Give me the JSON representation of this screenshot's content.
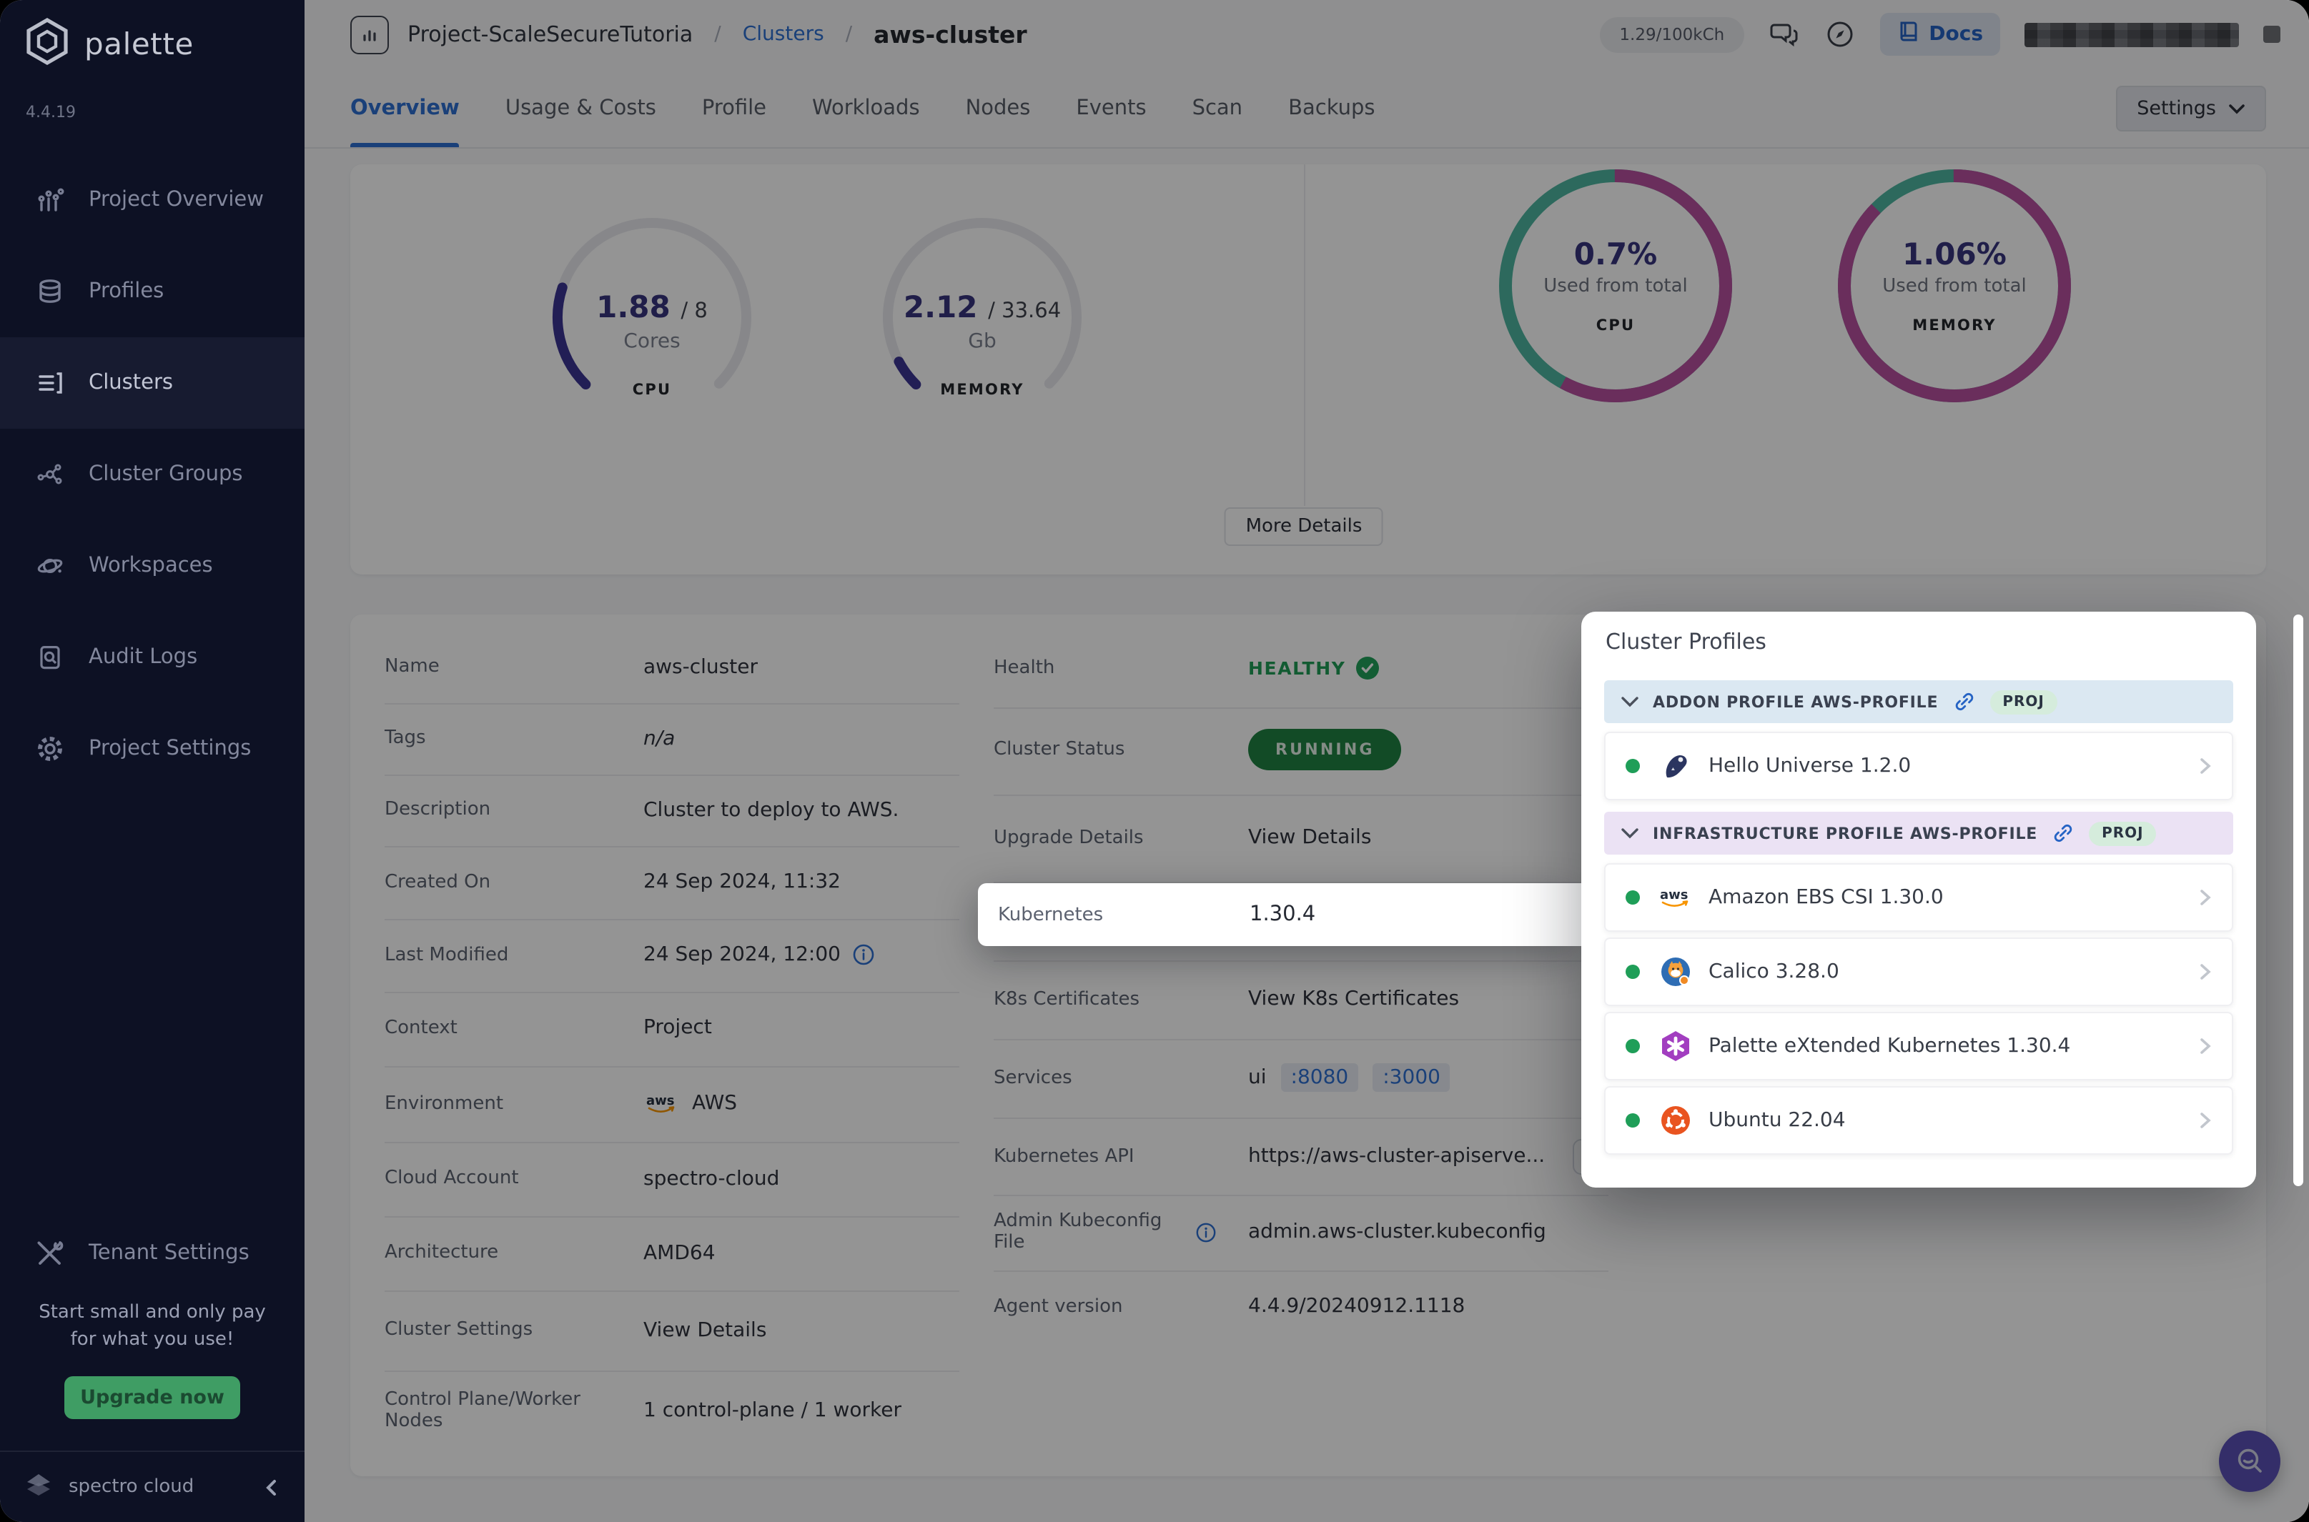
{
  "app": {
    "brand": "palette",
    "version": "4.4.19",
    "footer_brand": "spectro cloud"
  },
  "sidebar": {
    "items": [
      {
        "label": "Project Overview",
        "icon": "project-overview"
      },
      {
        "label": "Profiles",
        "icon": "profiles"
      },
      {
        "label": "Clusters",
        "icon": "clusters"
      },
      {
        "label": "Cluster Groups",
        "icon": "cluster-groups"
      },
      {
        "label": "Workspaces",
        "icon": "workspaces"
      },
      {
        "label": "Audit Logs",
        "icon": "audit-logs"
      },
      {
        "label": "Project Settings",
        "icon": "project-settings"
      }
    ],
    "selected": "Clusters",
    "tenant_label": "Tenant Settings",
    "promo": {
      "line1": "Start small and only pay",
      "line2": "for what you use!",
      "cta": "Upgrade now"
    }
  },
  "header": {
    "project": "Project-ScaleSecureTutoria",
    "separator": "/",
    "breadcrumb_section": "Clusters",
    "breadcrumb_current": "aws-cluster",
    "credits": "1.29/100kCh",
    "docs_label": "Docs"
  },
  "tabs": {
    "items": [
      "Overview",
      "Usage & Costs",
      "Profile",
      "Workloads",
      "Nodes",
      "Events",
      "Scan",
      "Backups"
    ],
    "active": "Overview",
    "settings_label": "Settings"
  },
  "usage": {
    "slash": "/",
    "gauges": [
      {
        "id": "cpu",
        "used": "1.88",
        "total": "8",
        "unit": "Cores",
        "label": "CPU",
        "fraction": 0.235
      },
      {
        "id": "memory",
        "used": "2.12",
        "total": "33.64",
        "unit": "Gb",
        "label": "MEMORY",
        "fraction": 0.063
      }
    ],
    "donuts": [
      {
        "id": "cpu",
        "percent": "0.7%",
        "caption": "Used from total",
        "label": "CPU",
        "used_fraction": 0.58
      },
      {
        "id": "memory",
        "percent": "1.06%",
        "caption": "Used from total",
        "label": "MEMORY",
        "used_fraction": 0.875
      }
    ],
    "more_details_label": "More Details"
  },
  "details": {
    "left": [
      {
        "label": "Name",
        "value": "aws-cluster"
      },
      {
        "label": "Tags",
        "value": "n/a"
      },
      {
        "label": "Description",
        "value": "Cluster to deploy to AWS."
      },
      {
        "label": "Created On",
        "value": "24 Sep 2024, 11:32"
      },
      {
        "label": "Last Modified",
        "value": "24 Sep 2024, 12:00"
      },
      {
        "label": "Context",
        "value": "Project"
      },
      {
        "label": "Environment",
        "value": "AWS"
      },
      {
        "label": "Cloud Account",
        "value": "spectro-cloud"
      },
      {
        "label": "Architecture",
        "value": "AMD64"
      },
      {
        "label": "Cluster Settings",
        "value": "View Details"
      },
      {
        "label": "Control Plane/Worker Nodes",
        "value": "1 control-plane / 1 worker"
      }
    ],
    "right": {
      "health": {
        "label": "Health",
        "value": "HEALTHY"
      },
      "status": {
        "label": "Cluster Status",
        "value": "RUNNING"
      },
      "upgrade": {
        "label": "Upgrade Details",
        "value": "View Details"
      },
      "kubernetes": {
        "label": "Kubernetes",
        "value": "1.30.4"
      },
      "certificates": {
        "label": "K8s Certificates",
        "value": "View K8s Certificates"
      },
      "services": {
        "label": "Services",
        "prefix": "ui",
        "ports": [
          ":8080",
          ":3000"
        ]
      },
      "api": {
        "label": "Kubernetes API",
        "value": "https://aws-cluster-apiserve..."
      },
      "kubeconfig": {
        "label": "Admin Kubeconfig File",
        "value": "admin.aws-cluster.kubeconfig"
      },
      "agent": {
        "label": "Agent version",
        "value": "4.4.9/20240912.1118"
      }
    }
  },
  "popup": {
    "title": "Cluster Profiles",
    "sections": [
      {
        "label": "ADDON PROFILE AWS-PROFILE",
        "badge": "PROJ",
        "items": [
          {
            "name": "Hello Universe 1.2.0",
            "icon": "hello-universe"
          }
        ]
      },
      {
        "label": "INFRASTRUCTURE PROFILE AWS-PROFILE",
        "badge": "PROJ",
        "items": [
          {
            "name": "Amazon EBS CSI 1.30.0",
            "icon": "aws"
          },
          {
            "name": "Calico 3.28.0",
            "icon": "calico"
          },
          {
            "name": "Palette eXtended Kubernetes 1.30.4",
            "icon": "pxk"
          },
          {
            "name": "Ubuntu 22.04",
            "icon": "ubuntu"
          }
        ]
      }
    ]
  },
  "colors": {
    "accent_blue": "#2e6fd0",
    "gauge_indigo": "#3c3493",
    "donut_magenta": "#b7509f",
    "donut_teal": "#4fb6a0",
    "green": "#1f9e57",
    "running_green": "#1f8243",
    "sidebar_bg": "#0d1124",
    "upgrade_green": "#3f9d64"
  }
}
